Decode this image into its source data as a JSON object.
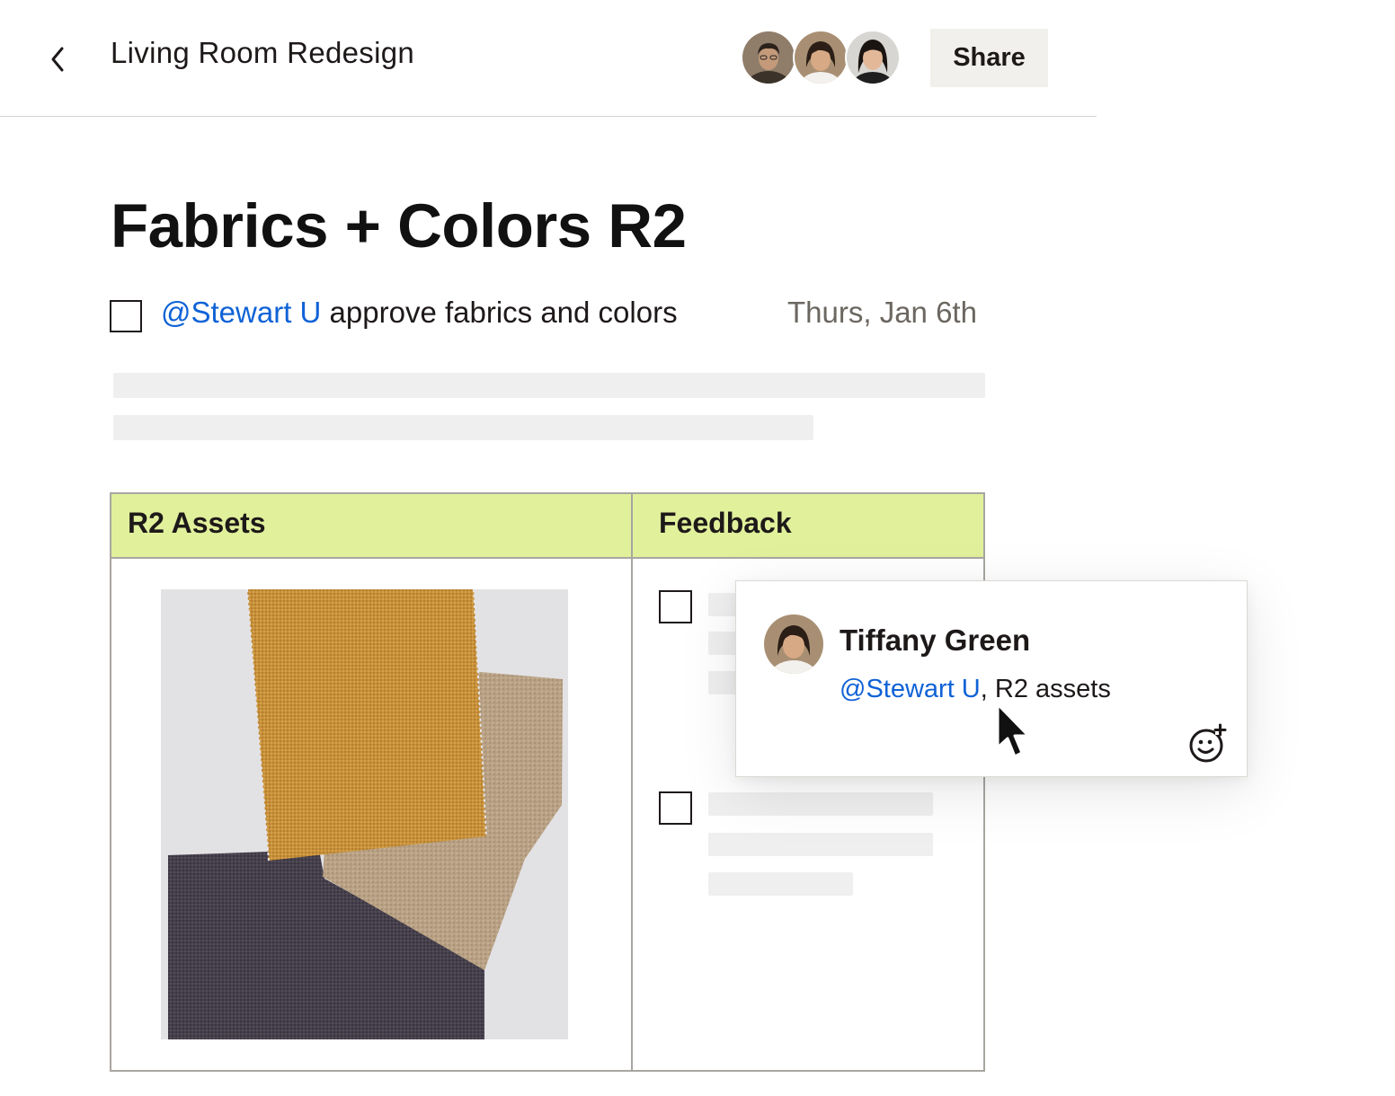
{
  "header": {
    "title": "Living Room Redesign",
    "share_label": "Share",
    "collaborators": [
      "collaborator-avatar-1",
      "collaborator-avatar-2",
      "collaborator-avatar-3"
    ]
  },
  "document": {
    "heading": "Fabrics + Colors R2",
    "task": {
      "mention": "@Stewart U",
      "text": " approve fabrics and colors",
      "date": "Thurs, Jan 6th",
      "checked": false
    }
  },
  "table": {
    "columns": [
      "R2 Assets",
      "Feedback"
    ],
    "asset_image": "fabric-swatches-image",
    "feedback_items": [
      {
        "checked": false
      },
      {
        "checked": false
      }
    ]
  },
  "comment": {
    "author": "Tiffany Green",
    "mention": "@Stewart U",
    "text": ", R2 assets",
    "reaction_icon": "add-emoji-icon"
  },
  "colors": {
    "accent_link": "#0f62d6",
    "table_header_bg": "#e0f09b",
    "share_bg": "#f2f0ec",
    "skeleton": "#efefef"
  }
}
